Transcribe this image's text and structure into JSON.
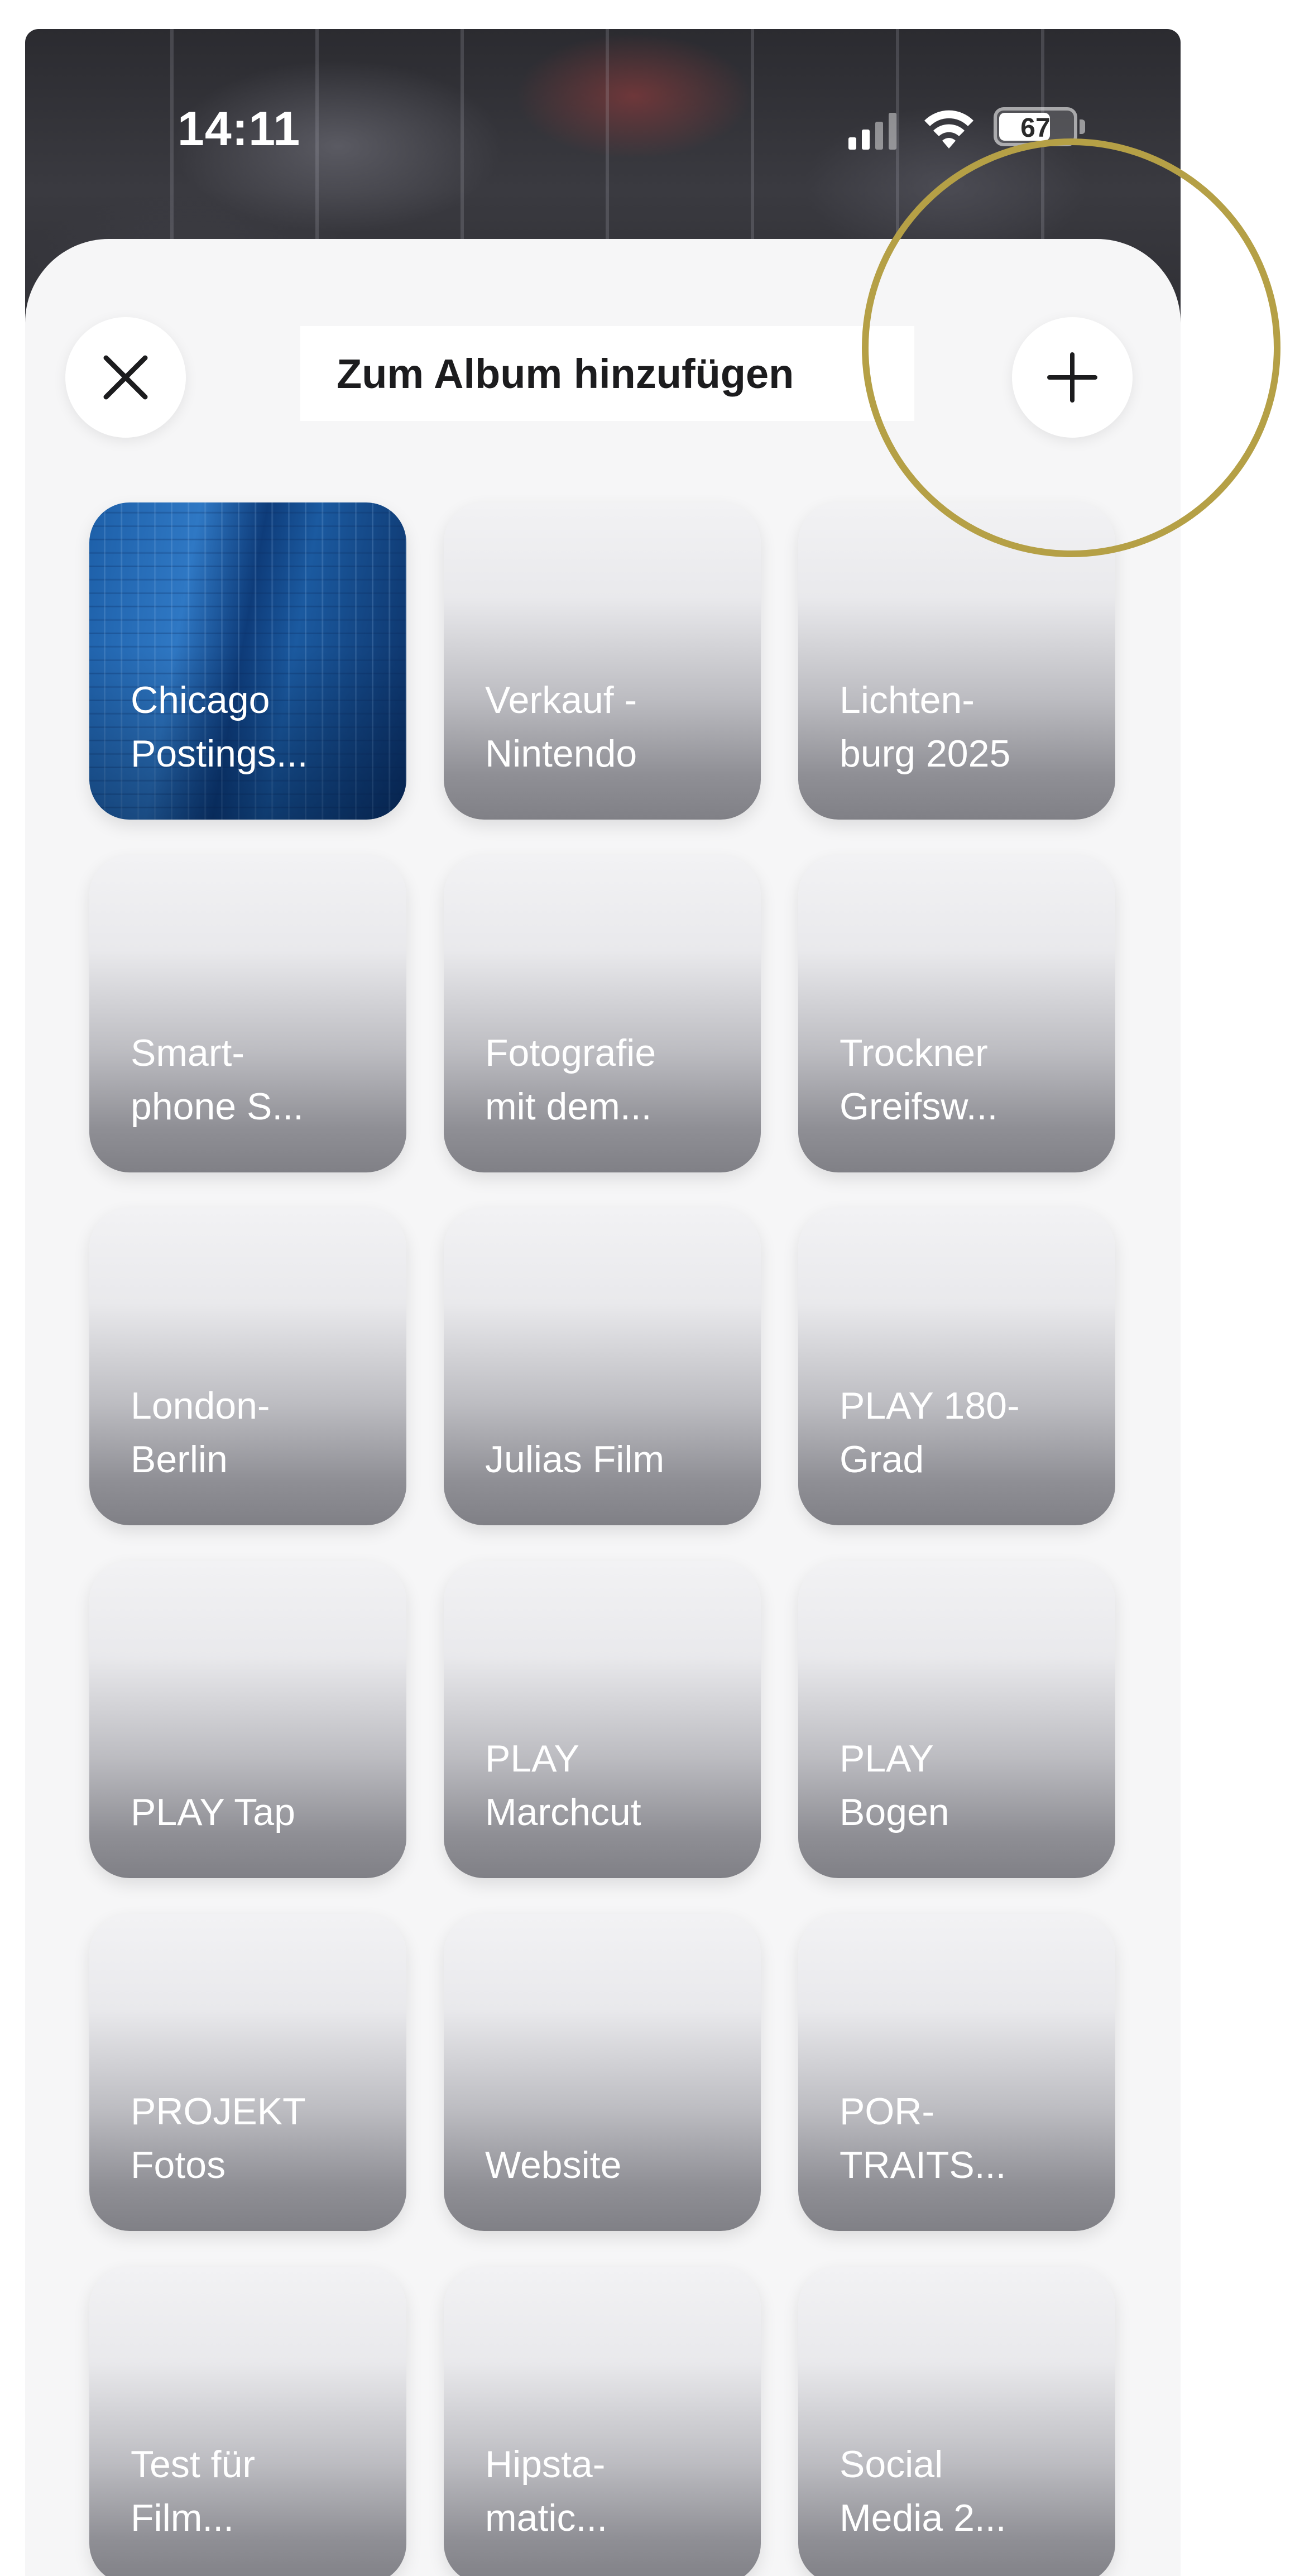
{
  "status_bar": {
    "time": "14:11",
    "battery": "67"
  },
  "sheet": {
    "title": "Zum Album hinzufügen",
    "close_icon": "close-icon",
    "add_icon": "plus-icon"
  },
  "albums": [
    {
      "line1": "Chicago",
      "line2": "Postings...",
      "has_cover": true
    },
    {
      "line1": "Verkauf -",
      "line2": "Nintendo"
    },
    {
      "line1": "Lichten-",
      "line2": "burg 2025"
    },
    {
      "line1": "Smart-",
      "line2": "phone S..."
    },
    {
      "line1": "Fotografie",
      "line2": "mit dem..."
    },
    {
      "line1": "Trockner",
      "line2": "Greifsw..."
    },
    {
      "line1": "London-",
      "line2": "Berlin"
    },
    {
      "line1": "",
      "line2": "Julias Film"
    },
    {
      "line1": "PLAY 180-",
      "line2": "Grad"
    },
    {
      "line1": "",
      "line2": "PLAY Tap"
    },
    {
      "line1": "PLAY",
      "line2": "Marchcut"
    },
    {
      "line1": "PLAY",
      "line2": "Bogen"
    },
    {
      "line1": "PROJEKT",
      "line2": "Fotos"
    },
    {
      "line1": "",
      "line2": "Website"
    },
    {
      "line1": "POR-",
      "line2": "TRAITS..."
    },
    {
      "line1": "Test für",
      "line2": "Film..."
    },
    {
      "line1": "Hipsta-",
      "line2": "matic..."
    },
    {
      "line1": "Social",
      "line2": "Media 2..."
    }
  ],
  "colors": {
    "highlight": "#b5a046",
    "sheet_background": "#f6f6f7"
  }
}
